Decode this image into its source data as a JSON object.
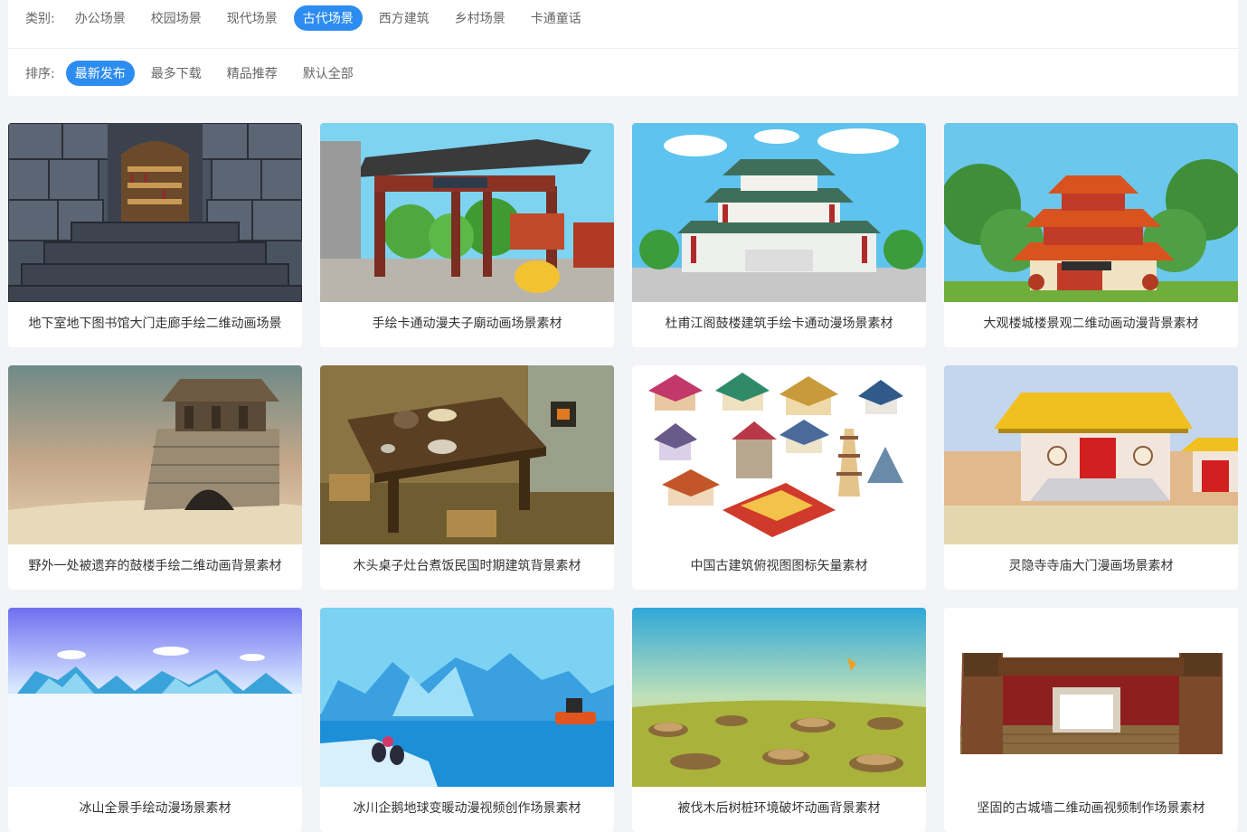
{
  "filters": {
    "category": {
      "label": "类别:",
      "options": [
        "办公场景",
        "校园场景",
        "现代场景",
        "古代场景",
        "西方建筑",
        "乡村场景",
        "卡通童话"
      ],
      "active": 3
    },
    "sort": {
      "label": "排序:",
      "options": [
        "最新发布",
        "最多下载",
        "精品推荐",
        "默认全部"
      ],
      "active": 0
    }
  },
  "colors": {
    "accent": "#2d8cf0"
  },
  "cards": [
    {
      "title": "地下室地下图书馆大门走廊手绘二维动画场景",
      "thumb": "dungeon-library"
    },
    {
      "title": "手绘卡通动漫夫子廟动画场景素材",
      "thumb": "temple-gate"
    },
    {
      "title": "杜甫江阁鼓楼建筑手绘卡通动漫场景素材",
      "thumb": "pavilion-tower"
    },
    {
      "title": "大观楼城楼景观二维动画动漫背景素材",
      "thumb": "daguan-tower"
    },
    {
      "title": "野外一处被遗弃的鼓楼手绘二维动画背景素材",
      "thumb": "ruined-watchtower"
    },
    {
      "title": "木头桌子灶台煮饭民国时期建筑背景素材",
      "thumb": "wooden-table-kitchen"
    },
    {
      "title": "中国古建筑俯视图图标矢量素材",
      "thumb": "isometric-buildings"
    },
    {
      "title": "灵隐寺寺庙大门漫画场景素材",
      "thumb": "temple-front"
    },
    {
      "title": "冰山全景手绘动漫场景素材",
      "thumb": "iceberg-panorama"
    },
    {
      "title": "冰川企鹅地球变暖动漫视频创作场景素材",
      "thumb": "glacier-penguins"
    },
    {
      "title": "被伐木后树桩环境破坏动画背景素材",
      "thumb": "tree-stumps"
    },
    {
      "title": "坚固的古城墙二维动画视频制作场景素材",
      "thumb": "city-wall"
    }
  ]
}
